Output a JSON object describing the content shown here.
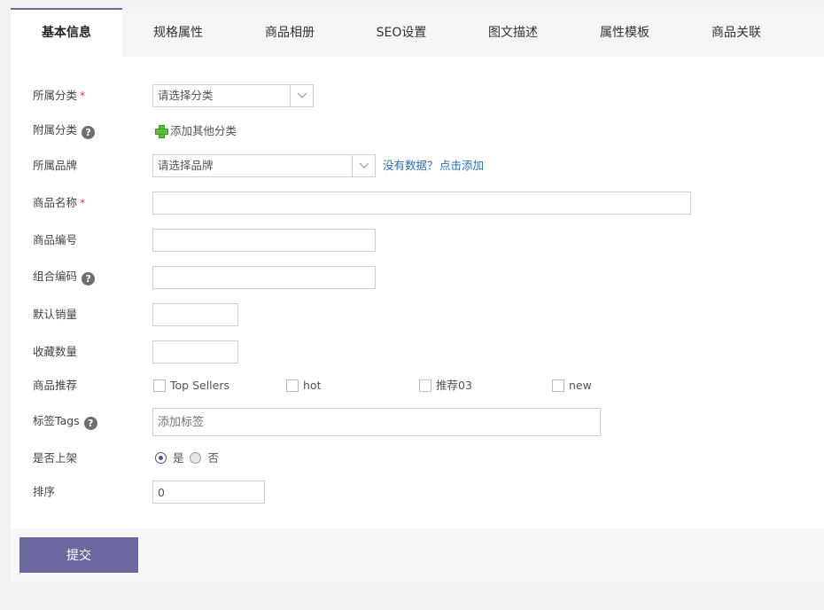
{
  "tabs": [
    {
      "label": "基本信息"
    },
    {
      "label": "规格属性"
    },
    {
      "label": "商品相册"
    },
    {
      "label": "SEO设置"
    },
    {
      "label": "图文描述"
    },
    {
      "label": "属性模板"
    },
    {
      "label": "商品关联"
    }
  ],
  "form": {
    "category": {
      "label": "所属分类",
      "required": "*",
      "value": "请选择分类"
    },
    "sub_category": {
      "label": "附属分类",
      "help": "?",
      "add_label": "添加其他分类"
    },
    "brand": {
      "label": "所属品牌",
      "value": "请选择品牌",
      "no_data": "没有数据？",
      "add_link": "点击添加"
    },
    "name": {
      "label": "商品名称",
      "required": "*",
      "value": ""
    },
    "code": {
      "label": "商品编号",
      "value": ""
    },
    "combo_code": {
      "label": "组合编码",
      "help": "?",
      "value": ""
    },
    "default_sales": {
      "label": "默认销量",
      "value": ""
    },
    "favorites": {
      "label": "收藏数量",
      "value": ""
    },
    "recommend": {
      "label": "商品推荐",
      "options": [
        {
          "label": "Top Sellers",
          "checked": false
        },
        {
          "label": "hot",
          "checked": false
        },
        {
          "label": "推荐03",
          "checked": false
        },
        {
          "label": "new",
          "checked": false
        }
      ]
    },
    "tags": {
      "label": "标签Tags",
      "help": "?",
      "placeholder": "添加标签"
    },
    "on_shelf": {
      "label": "是否上架",
      "yes": "是",
      "no": "否",
      "selected": "yes"
    },
    "sort": {
      "label": "排序",
      "value": "0"
    }
  },
  "footer": {
    "submit_label": "提交"
  },
  "colors": {
    "accent": "#6c68a0",
    "link": "#2b6ea8",
    "required": "#e43c3c"
  }
}
